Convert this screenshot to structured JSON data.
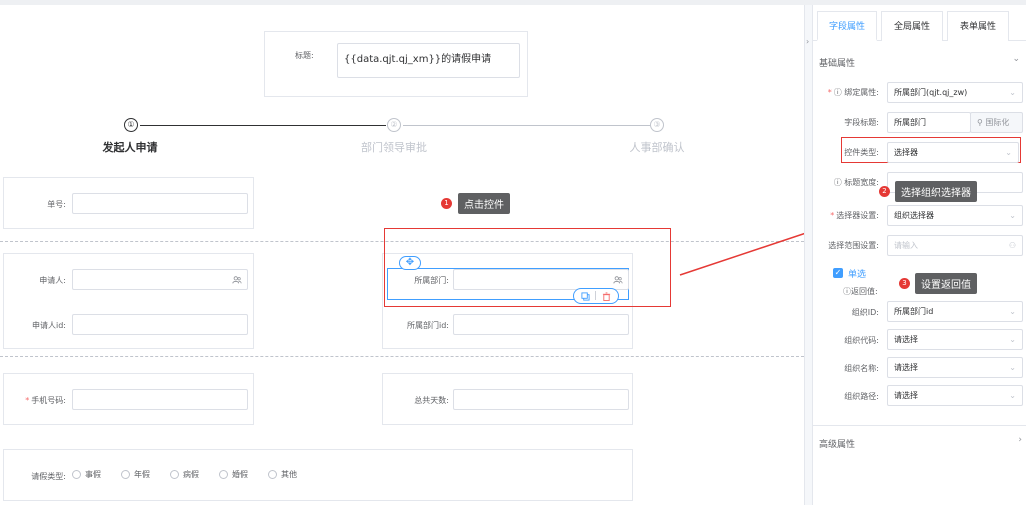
{
  "form": {
    "title_label": "标题:",
    "title_value": "{{data.qjt.qj_xm}}的请假申请",
    "steps": [
      {
        "num": "①",
        "title": "发起人申请"
      },
      {
        "num": "②",
        "title": "部门领导审批"
      },
      {
        "num": "③",
        "title": "人事部确认"
      }
    ],
    "fields": {
      "order_no": "单号:",
      "applicant": "申请人:",
      "applicant_id": "申请人id:",
      "department": "所属部门:",
      "department_id": "所属部门id:",
      "phone": "手机号码:",
      "total_days": "总共天数:",
      "leave_type": "请假类型:"
    },
    "leave_options": [
      "事假",
      "年假",
      "病假",
      "婚假",
      "其他"
    ]
  },
  "annotations": {
    "tip1_num": "1",
    "tip1": "点击控件",
    "tip2_num": "2",
    "tip2": "选择组织选择器",
    "tip3_num": "3",
    "tip3": "设置返回值"
  },
  "panel": {
    "tabs": [
      "字段属性",
      "全局属性",
      "表单属性"
    ],
    "basic_section": "基础属性",
    "bind_label": "绑定属性:",
    "bind_value": "所属部门(qjt.qj_zw)",
    "field_title_label": "字段标题:",
    "field_title_value": "所属部门",
    "i18n_button": "国际化",
    "control_type_label": "控件类型:",
    "control_type_value": "选择器",
    "label_width_label": "标题宽度:",
    "selector_setting_label": "选择器设置:",
    "selector_setting_value": "组织选择器",
    "range_label": "选择范围设置:",
    "range_placeholder": "请输入",
    "single_label": "单选",
    "return_label": "返回值:",
    "org_id_label": "组织ID:",
    "org_id_value": "所属部门id",
    "org_code_label": "组织代码:",
    "org_code_value": "请选择",
    "org_name_label": "组织名称:",
    "org_name_value": "请选择",
    "org_path_label": "组织路径:",
    "org_path_value": "请选择",
    "advanced_section": "高级属性"
  },
  "colors": {
    "accent": "#409eff",
    "annotation_red": "#e53935",
    "required": "#f56c6c",
    "tip_bg": "#5f6062"
  }
}
